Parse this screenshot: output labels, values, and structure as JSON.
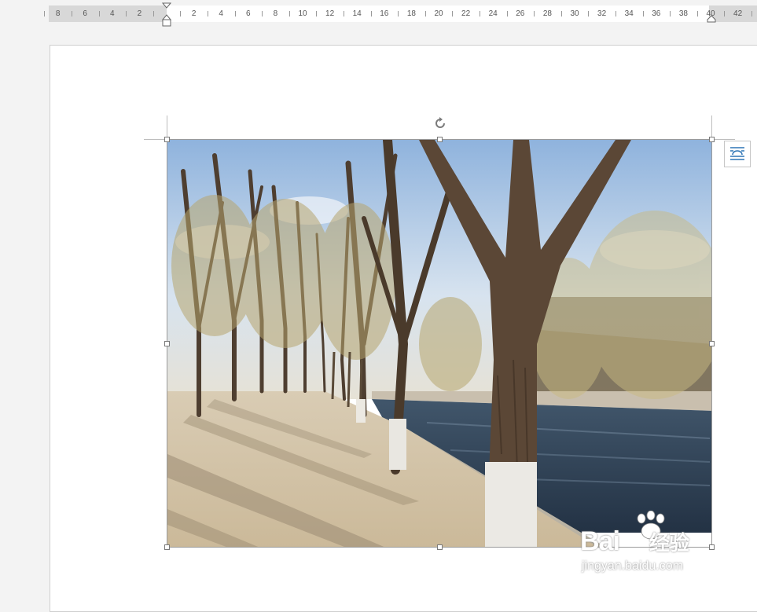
{
  "ruler": {
    "left_labels": [
      "8",
      "6",
      "4",
      "2"
    ],
    "right_labels": [
      "2",
      "4",
      "6",
      "8",
      "10",
      "12",
      "14",
      "16",
      "18",
      "20",
      "22",
      "24",
      "26",
      "28",
      "30",
      "32",
      "34",
      "36",
      "38",
      "40",
      "42"
    ]
  },
  "picture": {
    "description": "photo"
  },
  "watermark": {
    "brand": "Bai",
    "brand2": "经验",
    "url": "jingyan.baidu.com"
  },
  "icons": {
    "rotate": "rotate-icon",
    "layout": "layout-options-icon"
  }
}
